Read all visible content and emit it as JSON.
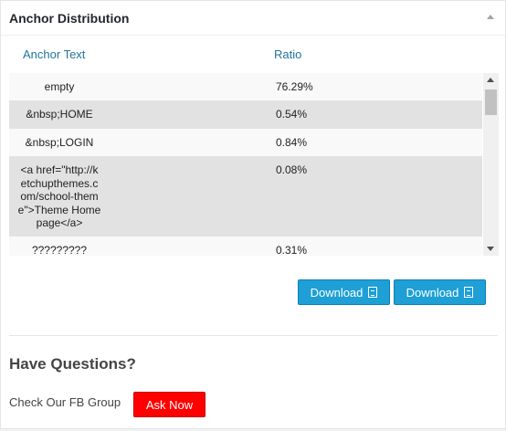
{
  "panel": {
    "title": "Anchor Distribution"
  },
  "table": {
    "headers": {
      "anchor": "Anchor Text",
      "ratio": "Ratio"
    },
    "rows": [
      {
        "anchor": "empty",
        "ratio": "76.29%"
      },
      {
        "anchor": "&nbsp;HOME",
        "ratio": "0.54%"
      },
      {
        "anchor": "&nbsp;LOGIN",
        "ratio": "0.84%"
      },
      {
        "anchor": "<a href=\"http://k\netchupthemes.c\nom/school-them\ne\">Theme Home\npage</a>",
        "ratio": "0.08%"
      },
      {
        "anchor": "?????????",
        "ratio": "0.31%"
      }
    ]
  },
  "actions": {
    "download_pdf": "Download",
    "download_xls": "Download"
  },
  "questions": {
    "title": "Have Questions?",
    "fb_text": "Check Our FB Group",
    "ask_label": "Ask Now"
  },
  "colors": {
    "link": "#21759b",
    "download_bg": "#1e9fd6",
    "ask_bg": "#ff0000"
  }
}
